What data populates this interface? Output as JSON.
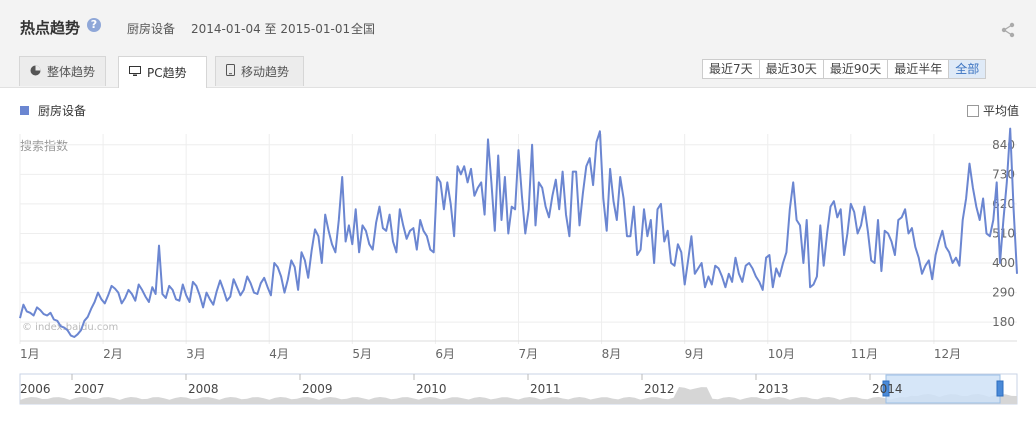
{
  "header": {
    "title": "热点趋势",
    "help_icon": "?",
    "keyword": "厨房设备",
    "date_range": "2014-01-04 至 2015-01-01",
    "region": "全国"
  },
  "tabs": [
    {
      "label": "整体趋势",
      "icon": "pie-chart-icon"
    },
    {
      "label": "PC趋势",
      "icon": "monitor-icon",
      "active": true
    },
    {
      "label": "移动趋势",
      "icon": "phone-icon"
    }
  ],
  "range_buttons": [
    {
      "label": "最近7天"
    },
    {
      "label": "最近30天"
    },
    {
      "label": "最近90天"
    },
    {
      "label": "最近半年"
    },
    {
      "label": "全部",
      "active": true
    }
  ],
  "legend": {
    "label": "厨房设备",
    "avg_label": "平均值"
  },
  "watermark": "© index.baidu.com",
  "colors": {
    "series": "#6b86d1",
    "header_bg": "#f3f3f3",
    "active_range": "#3a72c0"
  },
  "navigator": {
    "years": [
      "2006",
      "2007",
      "2008",
      "2009",
      "2010",
      "2011",
      "2012",
      "2013",
      "2014"
    ],
    "selected": "2014"
  },
  "chart_data": {
    "type": "line",
    "ylabel": "搜索指数",
    "yticks": [
      180,
      290,
      400,
      510,
      620,
      730,
      840
    ],
    "ylim": [
      110,
      880
    ],
    "xticks": [
      "1月",
      "2月",
      "3月",
      "4月",
      "5月",
      "6月",
      "7月",
      "8月",
      "9月",
      "10月",
      "11月",
      "12月"
    ],
    "series": [
      {
        "name": "厨房设备",
        "x_range": [
          "2014-01-04",
          "2015-01-01"
        ],
        "values": [
          195,
          245,
          220,
          215,
          205,
          235,
          225,
          210,
          205,
          215,
          190,
          185,
          165,
          160,
          150,
          130,
          125,
          135,
          150,
          185,
          200,
          230,
          255,
          290,
          265,
          250,
          280,
          315,
          305,
          290,
          250,
          270,
          300,
          285,
          260,
          320,
          300,
          275,
          255,
          310,
          285,
          465,
          285,
          270,
          315,
          300,
          265,
          260,
          320,
          280,
          255,
          330,
          315,
          280,
          235,
          290,
          265,
          245,
          295,
          335,
          300,
          260,
          275,
          340,
          310,
          280,
          300,
          350,
          325,
          290,
          285,
          325,
          345,
          310,
          280,
          400,
          385,
          350,
          290,
          340,
          410,
          385,
          300,
          440,
          410,
          345,
          445,
          525,
          500,
          400,
          580,
          520,
          470,
          440,
          560,
          720,
          480,
          540,
          470,
          600,
          440,
          540,
          520,
          470,
          450,
          550,
          610,
          530,
          520,
          580,
          480,
          440,
          600,
          540,
          490,
          520,
          530,
          450,
          560,
          520,
          500,
          450,
          440,
          720,
          700,
          600,
          700,
          620,
          500,
          760,
          730,
          760,
          700,
          750,
          650,
          680,
          700,
          580,
          860,
          700,
          520,
          800,
          560,
          720,
          510,
          610,
          600,
          820,
          650,
          510,
          600,
          840,
          540,
          700,
          680,
          610,
          570,
          650,
          710,
          600,
          740,
          580,
          500,
          740,
          740,
          540,
          660,
          760,
          790,
          690,
          850,
          890,
          640,
          520,
          750,
          630,
          560,
          720,
          640,
          500,
          500,
          610,
          430,
          450,
          600,
          500,
          560,
          400,
          600,
          620,
          480,
          520,
          400,
          390,
          470,
          440,
          320,
          410,
          500,
          360,
          380,
          400,
          310,
          350,
          320,
          390,
          380,
          350,
          310,
          360,
          330,
          420,
          360,
          330,
          390,
          400,
          380,
          350,
          330,
          300,
          420,
          430,
          310,
          380,
          350,
          400,
          440,
          600,
          700,
          560,
          540,
          400,
          560,
          310,
          320,
          350,
          540,
          390,
          510,
          610,
          630,
          570,
          600,
          430,
          510,
          620,
          590,
          510,
          540,
          610,
          520,
          410,
          400,
          560,
          370,
          520,
          510,
          480,
          430,
          560,
          570,
          600,
          510,
          530,
          460,
          420,
          360,
          390,
          410,
          340,
          430,
          480,
          520,
          460,
          440,
          400,
          420,
          390,
          560,
          640,
          770,
          680,
          610,
          560,
          640,
          510,
          500,
          560,
          700,
          400,
          560,
          700,
          900,
          600,
          360
        ]
      }
    ]
  }
}
